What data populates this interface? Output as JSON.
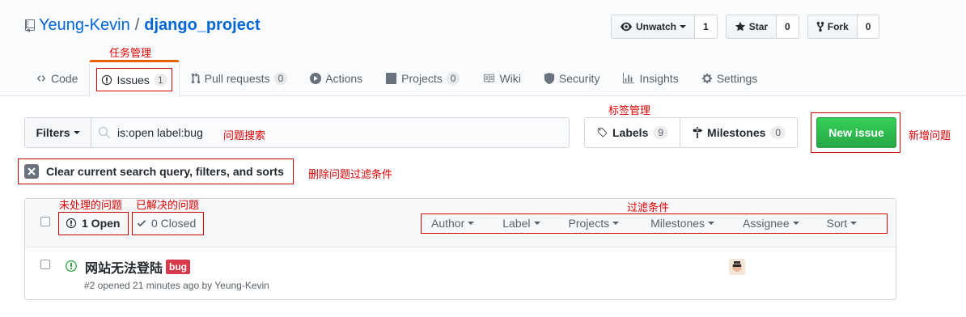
{
  "repo": {
    "owner": "Yeung-Kevin",
    "separator": "/",
    "name": "django_project"
  },
  "repo_actions": {
    "watch_label": "Unwatch",
    "watch_count": "1",
    "star_label": "Star",
    "star_count": "0",
    "fork_label": "Fork",
    "fork_count": "0"
  },
  "tabs": [
    {
      "label": "Code"
    },
    {
      "label": "Issues",
      "count": "1"
    },
    {
      "label": "Pull requests",
      "count": "0"
    },
    {
      "label": "Actions"
    },
    {
      "label": "Projects",
      "count": "0"
    },
    {
      "label": "Wiki"
    },
    {
      "label": "Security"
    },
    {
      "label": "Insights"
    },
    {
      "label": "Settings"
    }
  ],
  "toolbar": {
    "filters_label": "Filters",
    "search_value": "is:open label:bug",
    "labels_label": "Labels",
    "labels_count": "9",
    "milestones_label": "Milestones",
    "milestones_count": "0",
    "new_issue_label": "New issue"
  },
  "clear_label": "Clear current search query, filters, and sorts",
  "issues_header": {
    "open_label": "1 Open",
    "closed_label": "0 Closed",
    "menus": [
      "Author",
      "Label",
      "Projects",
      "Milestones",
      "Assignee",
      "Sort"
    ]
  },
  "issues": [
    {
      "title": "网站无法登陆",
      "label": "bug",
      "meta": "#2 opened 21 minutes ago by Yeung-Kevin"
    }
  ],
  "annotations": {
    "task_mgmt": "任务管理",
    "search": "问题搜索",
    "label_mgmt": "标签管理",
    "new_issue": "新增问题",
    "clear_filters": "删除问题过滤条件",
    "unresolved": "未处理的问题",
    "resolved": "已解决的问题",
    "filter_conditions": "过滤条件"
  },
  "colors": {
    "annotation": "#e00000",
    "accent": "#0366d6",
    "open_green": "#28a745",
    "bug_red": "#d73a4a"
  }
}
